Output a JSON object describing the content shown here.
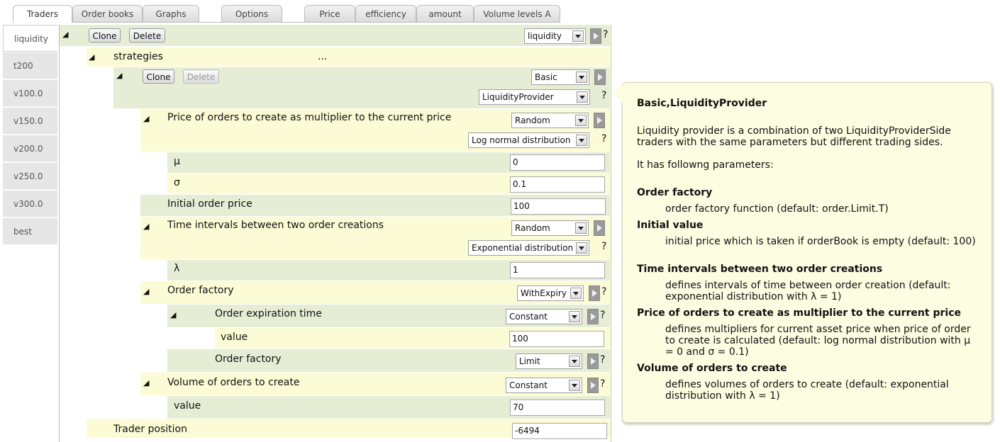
{
  "top_tabs": [
    "Traders",
    "Order books",
    "Graphs",
    "Options",
    "Price",
    "efficiency",
    "amount",
    "Volume levels A"
  ],
  "side_tabs": [
    "liquidity",
    "t200",
    "v100.0",
    "v150.0",
    "v200.0",
    "v250.0",
    "v300.0",
    "best"
  ],
  "trader": {
    "clone": "Clone",
    "delete": "Delete",
    "type": "liquidity",
    "help": "?"
  },
  "strategies": {
    "label": "strategies",
    "more": "..."
  },
  "strategy": {
    "clone": "Clone",
    "delete": "Delete",
    "kind": "Basic",
    "class": "LiquidityProvider",
    "help": "?"
  },
  "price": {
    "label": "Price of orders to create as multiplier to the current price",
    "kind": "Random",
    "dist": "Log normal distribution",
    "mu_label": "μ",
    "mu": "0",
    "sigma_label": "σ",
    "sigma": "0.1"
  },
  "initial": {
    "label": "Initial order price",
    "value": "100"
  },
  "time": {
    "label": "Time intervals between two order creations",
    "kind": "Random",
    "dist": "Exponential distribution",
    "lambda_label": "λ",
    "lambda": "1"
  },
  "factory": {
    "label": "Order factory",
    "kind": "WithExpiry",
    "expiry_label": "Order expiration time",
    "expiry_kind": "Constant",
    "expiry_value_label": "value",
    "expiry_value": "100",
    "inner_label": "Order factory",
    "inner_kind": "Limit"
  },
  "volume": {
    "label": "Volume of orders to create",
    "kind": "Constant",
    "value_label": "value",
    "value": "70"
  },
  "position": {
    "label": "Trader position",
    "value": "-6494"
  },
  "tooltip": {
    "title": "Basic,LiquidityProvider",
    "desc": "Liquidity provider is a combination of two LiquidityProviderSide traders with the same parameters but different trading sides.",
    "params_intro": "It has followng parameters:",
    "p1_name": "Order factory",
    "p1_desc": "order factory function (default: order.Limit.T)",
    "p2_name": "Initial value",
    "p2_desc": "initial price which is taken if orderBook is empty (default: 100)",
    "p3_name": "Time intervals between two order creations",
    "p3_desc": "defines intervals of time between order creation (default: exponential distribution with λ = 1)",
    "p4_name": "Price of orders to create as multiplier to the current price",
    "p4_desc": "defines multipliers for current asset price when price of order to create is calculated (default: log normal distribution with μ = 0 and σ = 0.1)",
    "p5_name": "Volume of orders to create",
    "p5_desc": "defines volumes of orders to create (default: exponential distribution with λ = 1)"
  }
}
